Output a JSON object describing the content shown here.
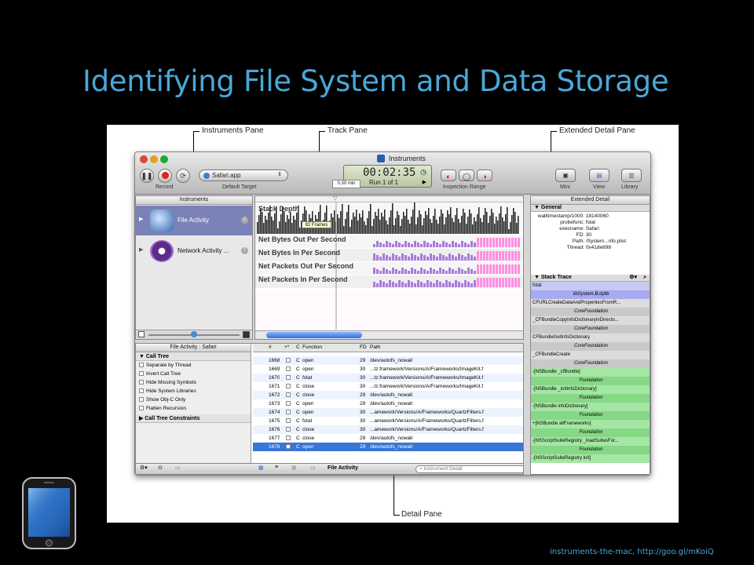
{
  "slide": {
    "title": "Identifying File System and Data Storage",
    "credit": "instruments-the-mac, http://goo.gl/mKoiQ"
  },
  "callouts": {
    "instruments_pane": "Instruments Pane",
    "track_pane": "Track Pane",
    "extended_pane": "Extended Detail Pane",
    "detail_pane": "Detail Pane"
  },
  "toolbar": {
    "window_title": "Instruments",
    "record_label": "Record",
    "target_value": "Safari.app",
    "target_label": "Default Target",
    "time": "00:02:35",
    "run": "Run 1 of 1",
    "min_value": "0.30 min",
    "inspection_label": "Inspection Range",
    "mini_label": "Mini",
    "view_label": "View",
    "library_label": "Library"
  },
  "instruments": {
    "header": "Instruments",
    "items": [
      {
        "label": "File Activity",
        "icon": "file-activity-icon"
      },
      {
        "label": "Network Activity ...",
        "icon": "network-activity-icon"
      }
    ]
  },
  "tracks": {
    "stack_depth": "Stack Depth",
    "frames_tip": "82 Frames",
    "rows": [
      "Net Bytes Out Per Second",
      "Net Bytes In Per Second",
      "Net Packets Out Per Second",
      "Net Packets In Per Second"
    ]
  },
  "extended": {
    "header": "Extended Detail",
    "general_label": "General",
    "fields": [
      {
        "k": "walltimestamp/1000:",
        "v": "18140060"
      },
      {
        "k": "probefunc:",
        "v": "fstat"
      },
      {
        "k": "execname:",
        "v": "Safari"
      },
      {
        "k": "FD:",
        "v": "30"
      },
      {
        "k": "Path:",
        "v": "/System...nfo.plist"
      },
      {
        "k": "Thread:",
        "v": "0x41de698"
      }
    ],
    "stack_label": "Stack Trace",
    "frames": [
      {
        "t": "fstat",
        "kind": "fn",
        "c": "#c7c9f3"
      },
      {
        "t": "libSystem.B.dylib",
        "kind": "lib",
        "c": "#a8aaf0"
      },
      {
        "t": "CFURLCreateDataAndPropertiesFromR...",
        "kind": "fn",
        "c": "#dcdcdc"
      },
      {
        "t": "CoreFoundation",
        "kind": "lib",
        "c": "#c9c9c9"
      },
      {
        "t": "_CFBundleCopyInfoDictionaryInDirecto...",
        "kind": "fn",
        "c": "#dcdcdc"
      },
      {
        "t": "CoreFoundation",
        "kind": "lib",
        "c": "#c9c9c9"
      },
      {
        "t": "CFBundleGetInfoDictionary",
        "kind": "fn",
        "c": "#dcdcdc"
      },
      {
        "t": "CoreFoundation",
        "kind": "lib",
        "c": "#c9c9c9"
      },
      {
        "t": "_CFBundleCreate",
        "kind": "fn",
        "c": "#dcdcdc"
      },
      {
        "t": "CoreFoundation",
        "kind": "lib",
        "c": "#c9c9c9"
      },
      {
        "t": "-[NSBundle _cfBundle]",
        "kind": "fn",
        "c": "#a4e6a4"
      },
      {
        "t": "Foundation",
        "kind": "lib",
        "c": "#86d886"
      },
      {
        "t": "-[NSBundle _initInfoDictionary]",
        "kind": "fn",
        "c": "#a4e6a4"
      },
      {
        "t": "Foundation",
        "kind": "lib",
        "c": "#86d886"
      },
      {
        "t": "-[NSBundle infoDictionary]",
        "kind": "fn",
        "c": "#a4e6a4"
      },
      {
        "t": "Foundation",
        "kind": "lib",
        "c": "#86d886"
      },
      {
        "t": "+[NSBundle allFrameworks]",
        "kind": "fn",
        "c": "#a4e6a4"
      },
      {
        "t": "Foundation",
        "kind": "lib",
        "c": "#86d886"
      },
      {
        "t": "-[NSScriptSuiteRegistry _loadSuitesFor...",
        "kind": "fn",
        "c": "#a4e6a4"
      },
      {
        "t": "Foundation",
        "kind": "lib",
        "c": "#86d886"
      },
      {
        "t": "-[NSScriptSuiteRegistry init]",
        "kind": "fn",
        "c": "#a4e6a4"
      }
    ]
  },
  "detail": {
    "header": "File Activity : Safari",
    "call_tree": "Call Tree",
    "options": [
      "Separate by Thread",
      "Invert Call Tree",
      "Hide Missing Symbols",
      "Hide System Libraries",
      "Show Obj-C Only",
      "Flatten Recursion"
    ],
    "constraints": "Call Tree Constraints",
    "columns": [
      "#",
      "+*",
      "C",
      "Function",
      "FD",
      "Path"
    ],
    "rows": [
      {
        "n": "1668",
        "c": "C",
        "fn": "open",
        "fd": "29",
        "path": "/dev/autofs_nowait"
      },
      {
        "n": "1669",
        "c": "C",
        "fn": "open",
        "fd": "30",
        "path": "...tz.framework/Versions/A/Frameworks/ImageKit.f"
      },
      {
        "n": "1670",
        "c": "C",
        "fn": "fstat",
        "fd": "30",
        "path": "...tz.framework/Versions/A/Frameworks/ImageKit.f"
      },
      {
        "n": "1671",
        "c": "C",
        "fn": "close",
        "fd": "30",
        "path": "...tz.framework/Versions/A/Frameworks/ImageKit.f"
      },
      {
        "n": "1672",
        "c": "C",
        "fn": "close",
        "fd": "29",
        "path": "/dev/autofs_nowait"
      },
      {
        "n": "1673",
        "c": "C",
        "fn": "open",
        "fd": "29",
        "path": "/dev/autofs_nowait"
      },
      {
        "n": "1674",
        "c": "C",
        "fn": "open",
        "fd": "30",
        "path": "...amework/Versions/A/Frameworks/QuartzFilters.f"
      },
      {
        "n": "1675",
        "c": "C",
        "fn": "fstat",
        "fd": "30",
        "path": "...amework/Versions/A/Frameworks/QuartzFilters.f"
      },
      {
        "n": "1676",
        "c": "C",
        "fn": "close",
        "fd": "30",
        "path": "...amework/Versions/A/Frameworks/QuartzFilters.f"
      },
      {
        "n": "1677",
        "c": "C",
        "fn": "close",
        "fd": "29",
        "path": "/dev/autofs_nowait"
      },
      {
        "n": "1678",
        "c": "C",
        "fn": "open",
        "fd": "29",
        "path": "/dev/autofs_nowait"
      }
    ],
    "footer_label": "File Activity",
    "search_placeholder": "Instrument Detail"
  },
  "colors": {
    "title": "#4aa8d8",
    "selection": "#3875d7",
    "track_bars": "#a97bdc",
    "track_bars_right": "#ff8fe0"
  }
}
